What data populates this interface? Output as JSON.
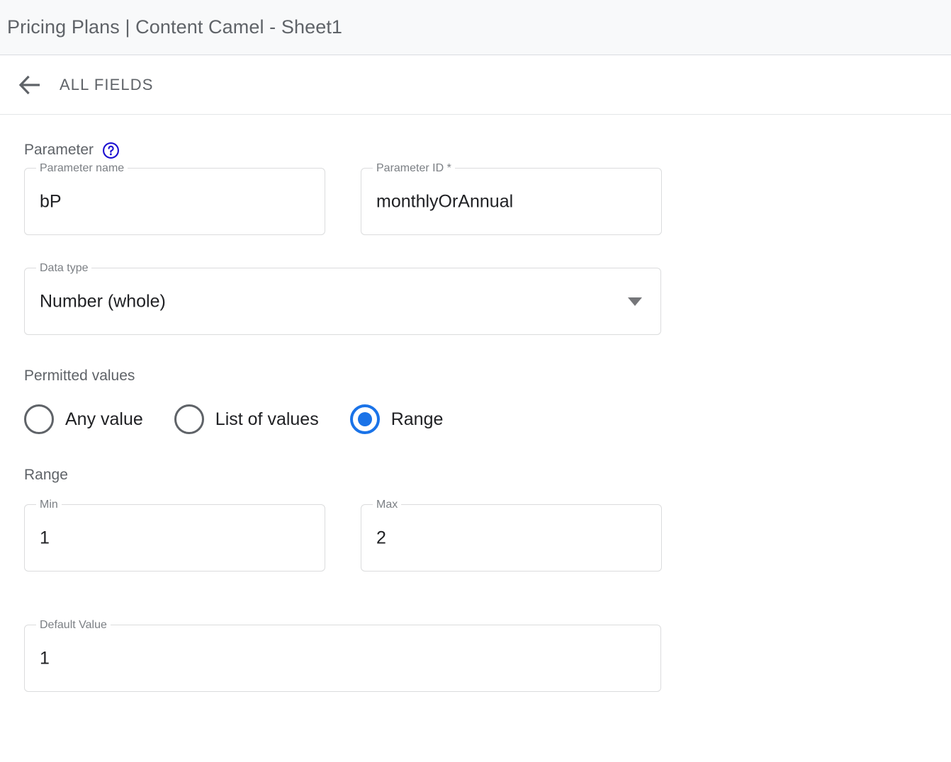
{
  "titlebar": {
    "title": "Pricing Plans | Content Camel - Sheet1"
  },
  "fieldsbar": {
    "back_label": "ALL FIELDS",
    "back_icon": "arrow-left-icon"
  },
  "parameter_section": {
    "heading": "Parameter",
    "help_icon": "help-circle-icon",
    "help_color": "#1a0dd1",
    "fields": [
      {
        "label": "Parameter name",
        "value": "bP"
      },
      {
        "label": "Parameter ID *",
        "value": "monthlyOrAnnual"
      }
    ],
    "data_type": {
      "label": "Data type",
      "value": "Number (whole)",
      "dropdown_icon": "chevron-down-icon"
    }
  },
  "permitted_values": {
    "heading": "Permitted values",
    "options": [
      {
        "label": "Any value",
        "selected": false
      },
      {
        "label": "List of values",
        "selected": false
      },
      {
        "label": "Range",
        "selected": true
      }
    ],
    "accent_color": "#1a73e8"
  },
  "range_section": {
    "heading": "Range",
    "min": {
      "label": "Min",
      "value": "1"
    },
    "max": {
      "label": "Max",
      "value": "2"
    }
  },
  "default_value": {
    "label": "Default Value",
    "value": "1"
  }
}
